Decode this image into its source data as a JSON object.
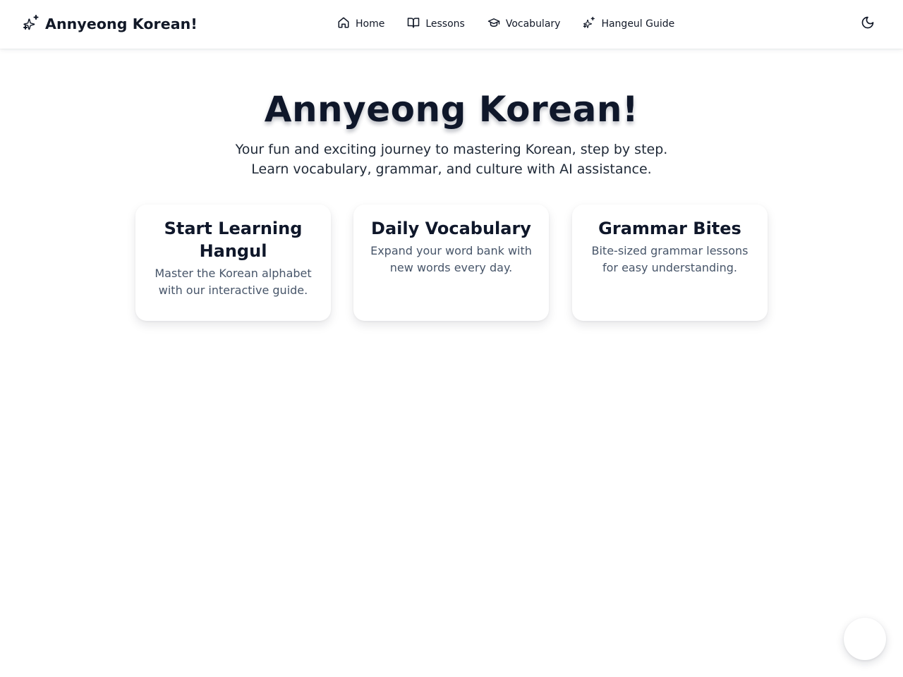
{
  "header": {
    "brand_title": "Annyeong Korean!",
    "brand_icon": "sparkles-icon",
    "nav": [
      {
        "label": "Home",
        "icon": "home-icon"
      },
      {
        "label": "Lessons",
        "icon": "book-open-icon"
      },
      {
        "label": "Vocabulary",
        "icon": "graduation-cap-icon"
      },
      {
        "label": "Hangeul Guide",
        "icon": "sparkles-icon"
      }
    ],
    "theme_toggle_icon": "moon-icon"
  },
  "hero": {
    "title": "Annyeong Korean!",
    "subtitle_line1": "Your fun and exciting journey to mastering Korean, step by step.",
    "subtitle_line2": "Learn vocabulary, grammar, and culture with AI assistance."
  },
  "cards": [
    {
      "title": "Start Learning Hangul",
      "description": "Master the Korean alphabet with our interactive guide."
    },
    {
      "title": "Daily Vocabulary",
      "description": "Expand your word bank with new words every day."
    },
    {
      "title": "Grammar Bites",
      "description": "Bite-sized grammar lessons for easy understanding."
    }
  ],
  "colors": {
    "text_primary": "#0f172a",
    "text_secondary": "#475569",
    "background": "#ffffff"
  }
}
